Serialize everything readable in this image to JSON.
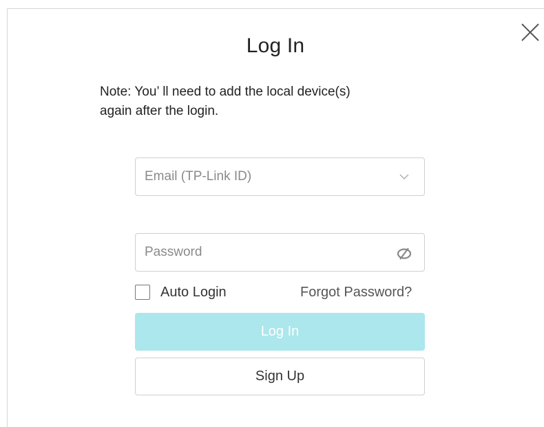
{
  "dialog": {
    "title": "Log In",
    "close_icon": "close-icon",
    "note_line1": "Note:  You’  ll need to add the local device(s)",
    "note_line2": "again after the login."
  },
  "form": {
    "email": {
      "placeholder": "Email (TP-Link ID)",
      "value": "",
      "icon": "chevron-down-icon"
    },
    "password": {
      "placeholder": "Password",
      "value": "",
      "icon": "eye-slash-icon"
    },
    "auto_login": {
      "label": "Auto Login",
      "checked": false
    },
    "forgot_password": "Forgot Password?",
    "login_button": "Log In",
    "signup_button": "Sign Up"
  },
  "colors": {
    "login_button_bg": "#abe7ec",
    "login_button_text": "#ffffff",
    "border": "#cfcfcf"
  }
}
